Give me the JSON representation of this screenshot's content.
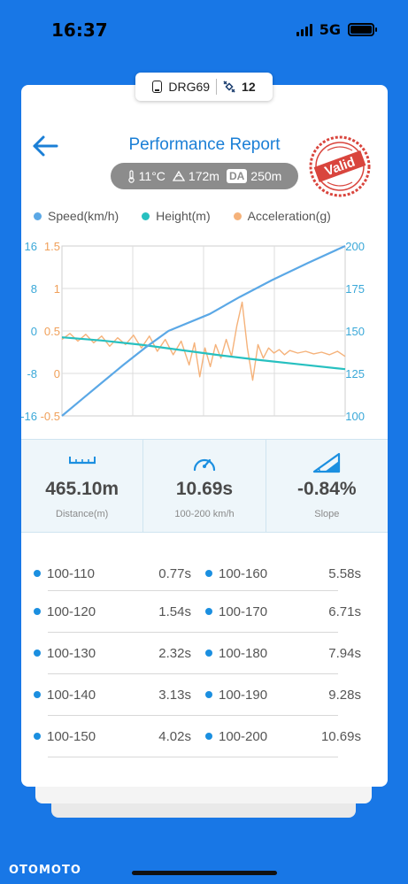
{
  "status_bar": {
    "time": "16:37",
    "network": "5G"
  },
  "device": {
    "name": "DRG69",
    "satellites": "12"
  },
  "header": {
    "title": "Performance Report",
    "stamp_text": "Valid"
  },
  "conditions": {
    "temperature": "11°C",
    "altitude": "172m",
    "da_label": "DA",
    "density_altitude": "250m"
  },
  "legend": [
    {
      "label": "Speed(km/h)",
      "color": "#5ba8e6"
    },
    {
      "label": "Height(m)",
      "color": "#27c0c0"
    },
    {
      "label": "Acceleration(g)",
      "color": "#f5b27a"
    }
  ],
  "chart_data": {
    "type": "line",
    "left_axis_height_ticks": [
      "16",
      "8",
      "0",
      "-8",
      "-16"
    ],
    "left_axis_height_range": [
      -16,
      16
    ],
    "left_axis_accel_ticks": [
      "1.5",
      "1",
      "0.5",
      "0",
      "-0.5"
    ],
    "left_axis_accel_range": [
      -0.5,
      1.5
    ],
    "right_axis_speed_ticks": [
      "200",
      "175",
      "150",
      "125",
      "100"
    ],
    "right_axis_speed_range": [
      100,
      200
    ],
    "x_range": [
      0,
      10.69
    ],
    "grid": true,
    "series": [
      {
        "name": "Speed(km/h)",
        "axis": "speed",
        "color": "#5ba8e6",
        "x": [
          0,
          0.77,
          1.54,
          2.32,
          3.13,
          4.02,
          5.58,
          6.71,
          7.94,
          9.28,
          10.69
        ],
        "y": [
          100,
          110,
          120,
          130,
          140,
          150,
          160,
          170,
          180,
          190,
          200
        ]
      },
      {
        "name": "Height(m)",
        "axis": "height",
        "color": "#27c0c0",
        "x": [
          0,
          1.5,
          3,
          4.5,
          6,
          7.5,
          9,
          10.69
        ],
        "y": [
          -1.2,
          -1.8,
          -2.6,
          -3.6,
          -4.6,
          -5.5,
          -6.3,
          -7.2
        ]
      },
      {
        "name": "Acceleration(g)",
        "axis": "accel",
        "color": "#f5b27a",
        "x": [
          0,
          0.3,
          0.6,
          0.9,
          1.2,
          1.5,
          1.8,
          2.1,
          2.4,
          2.7,
          3.0,
          3.3,
          3.6,
          3.9,
          4.2,
          4.5,
          4.8,
          5.0,
          5.2,
          5.4,
          5.6,
          5.8,
          6.0,
          6.2,
          6.4,
          6.6,
          6.8,
          7.0,
          7.2,
          7.4,
          7.6,
          7.8,
          8.0,
          8.2,
          8.4,
          8.6,
          8.9,
          9.2,
          9.5,
          9.8,
          10.1,
          10.4,
          10.69
        ],
        "y": [
          0.4,
          0.47,
          0.38,
          0.46,
          0.36,
          0.44,
          0.32,
          0.42,
          0.34,
          0.45,
          0.3,
          0.44,
          0.26,
          0.4,
          0.22,
          0.38,
          0.1,
          0.36,
          -0.04,
          0.3,
          0.08,
          0.34,
          0.18,
          0.4,
          0.2,
          0.56,
          0.84,
          0.3,
          -0.08,
          0.34,
          0.18,
          0.3,
          0.24,
          0.28,
          0.22,
          0.27,
          0.24,
          0.26,
          0.23,
          0.25,
          0.22,
          0.26,
          0.2
        ]
      }
    ]
  },
  "stats": [
    {
      "value": "465.10m",
      "label": "Distance(m)"
    },
    {
      "value": "10.69s",
      "label": "100-200 km/h"
    },
    {
      "value": "-0.84%",
      "label": "Slope"
    }
  ],
  "splits_left": [
    {
      "label": "100-110",
      "value": "0.77s"
    },
    {
      "label": "100-120",
      "value": "1.54s"
    },
    {
      "label": "100-130",
      "value": "2.32s"
    },
    {
      "label": "100-140",
      "value": "3.13s"
    },
    {
      "label": "100-150",
      "value": "4.02s"
    }
  ],
  "splits_right": [
    {
      "label": "100-160",
      "value": "5.58s"
    },
    {
      "label": "100-170",
      "value": "6.71s"
    },
    {
      "label": "100-180",
      "value": "7.94s"
    },
    {
      "label": "100-190",
      "value": "9.28s"
    },
    {
      "label": "100-200",
      "value": "10.69s"
    }
  ],
  "footer": {
    "watermark": "OTOMOTO"
  }
}
